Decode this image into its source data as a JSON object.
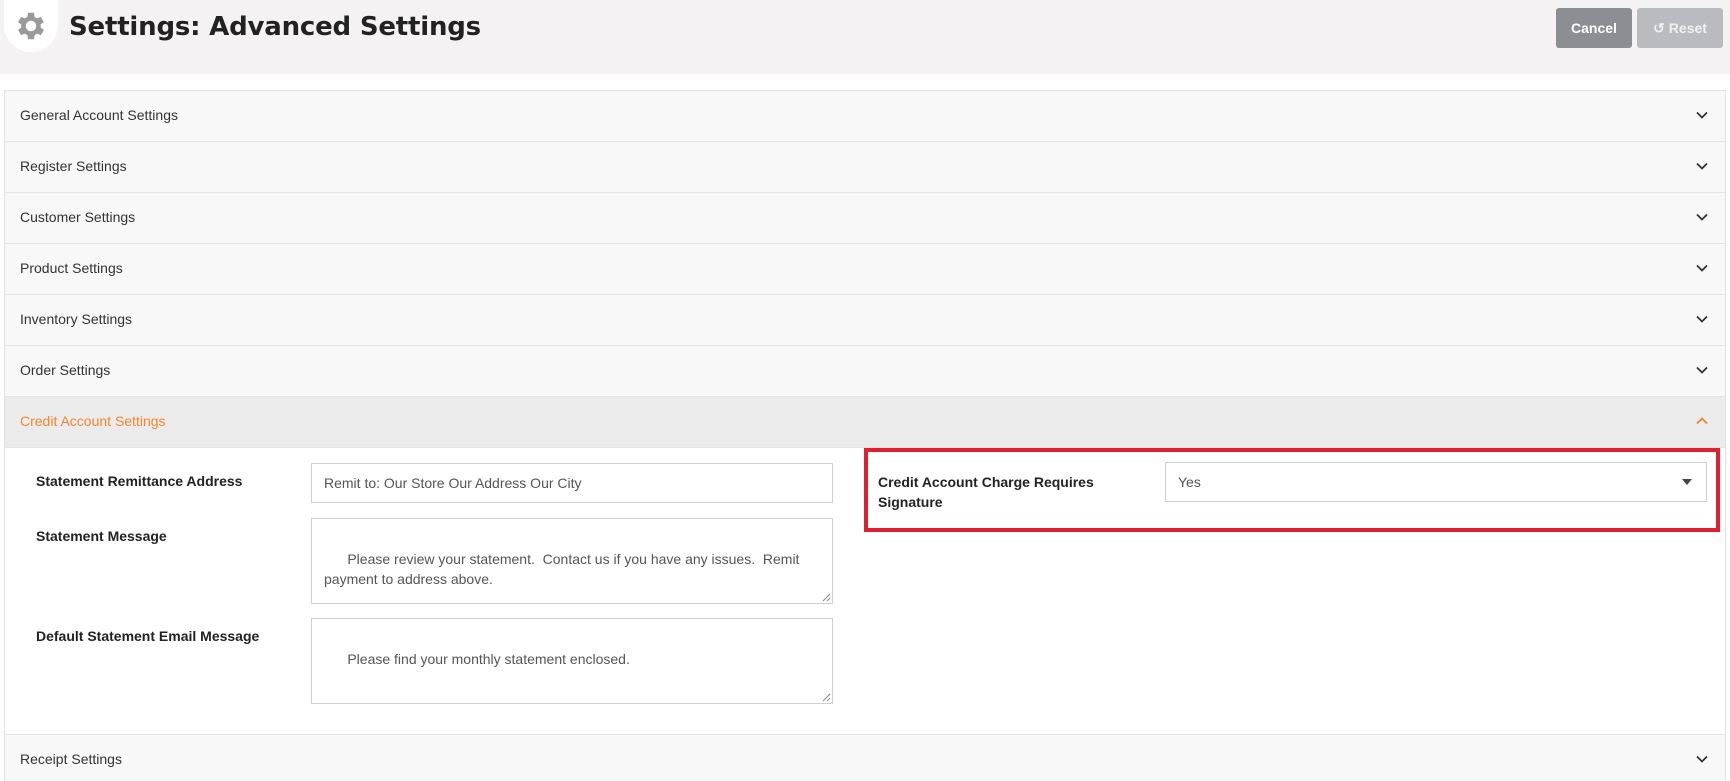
{
  "header": {
    "title": "Settings: Advanced Settings",
    "cancel_label": "Cancel",
    "reset_label": "Reset",
    "reset_icon": "↺"
  },
  "sections": [
    {
      "label": "General Account Settings"
    },
    {
      "label": "Register Settings"
    },
    {
      "label": "Customer Settings"
    },
    {
      "label": "Product Settings"
    },
    {
      "label": "Inventory Settings"
    },
    {
      "label": "Order Settings"
    },
    {
      "label": "Credit Account Settings"
    },
    {
      "label": "Receipt Settings"
    }
  ],
  "credit_account": {
    "remittance_label": "Statement Remittance Address",
    "remittance_value": "Remit to:  Our Store   Our Address  Our City",
    "message_label": "Statement Message",
    "message_value": "Please review your statement.  Contact us if you have any issues.  Remit payment to address above.",
    "email_label": "Default Statement Email Message",
    "email_value": "Please find your monthly statement enclosed.",
    "signature_label": "Credit Account Charge Requires Signature",
    "signature_value": "Yes"
  },
  "colors": {
    "active_section": "#f0862e",
    "highlight": "#e0202c",
    "cancel_button": "#8b8f94",
    "reset_button": "#b8bcc0"
  }
}
